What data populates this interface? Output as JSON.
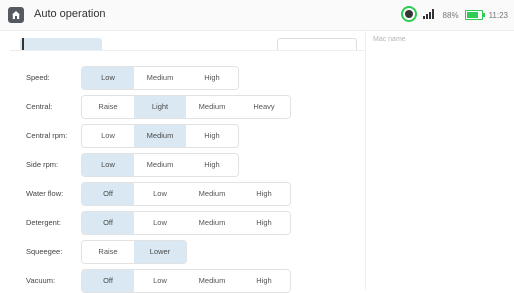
{
  "header": {
    "title": "Auto operation",
    "battery_percent": "88%",
    "battery_level": 0.88,
    "time": "11:23"
  },
  "panel": {
    "mac_label": "Mac name"
  },
  "settings": [
    {
      "label": "Speed:",
      "options": [
        "Low",
        "Medium",
        "High"
      ],
      "selected": 0
    },
    {
      "label": "Central:",
      "options": [
        "Raise",
        "Light",
        "Medium",
        "Heavy"
      ],
      "selected": 1
    },
    {
      "label": "Central rpm:",
      "options": [
        "Low",
        "Medium",
        "High"
      ],
      "selected": 1
    },
    {
      "label": "Side rpm:",
      "options": [
        "Low",
        "Medium",
        "High"
      ],
      "selected": 0
    },
    {
      "label": "Water flow:",
      "options": [
        "Off",
        "Low",
        "Medium",
        "High"
      ],
      "selected": 0
    },
    {
      "label": "Detergent:",
      "options": [
        "Off",
        "Low",
        "Medium",
        "High"
      ],
      "selected": 0
    },
    {
      "label": "Squeegee:",
      "options": [
        "Raise",
        "Lower"
      ],
      "selected": 1
    },
    {
      "label": "Vacuum:",
      "options": [
        "Off",
        "Low",
        "Medium",
        "High"
      ],
      "selected": 0
    }
  ],
  "colors": {
    "selected_bg": "#d9e8f2",
    "accent_green": "#2ecc55"
  }
}
